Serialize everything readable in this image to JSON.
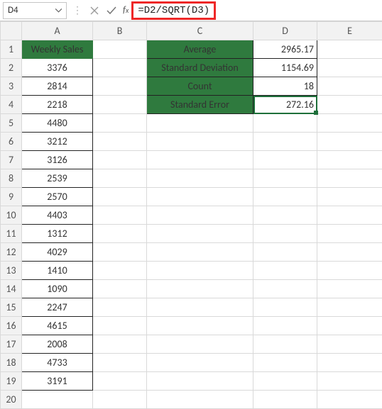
{
  "namebox": {
    "value": "D4"
  },
  "formula_bar": {
    "formula": "=D2/SQRT(D3)"
  },
  "columns": [
    "A",
    "B",
    "C",
    "D",
    "E"
  ],
  "rows": [
    "1",
    "2",
    "3",
    "4",
    "5",
    "6",
    "7",
    "8",
    "9",
    "10",
    "11",
    "12",
    "13",
    "14",
    "15",
    "16",
    "17",
    "18",
    "19",
    "20"
  ],
  "colA_header": "Weekly Sales",
  "colA_values": [
    "3376",
    "2814",
    "2218",
    "4480",
    "3212",
    "3126",
    "2539",
    "2570",
    "4403",
    "1312",
    "4029",
    "1410",
    "1090",
    "2247",
    "4615",
    "2008",
    "4733",
    "3191"
  ],
  "stats": [
    {
      "label": "Average",
      "value": "2965.17"
    },
    {
      "label": "Standard Deviation",
      "value": "1154.69"
    },
    {
      "label": "Count",
      "value": "18"
    },
    {
      "label": "Standard Error",
      "value": "272.16"
    }
  ]
}
